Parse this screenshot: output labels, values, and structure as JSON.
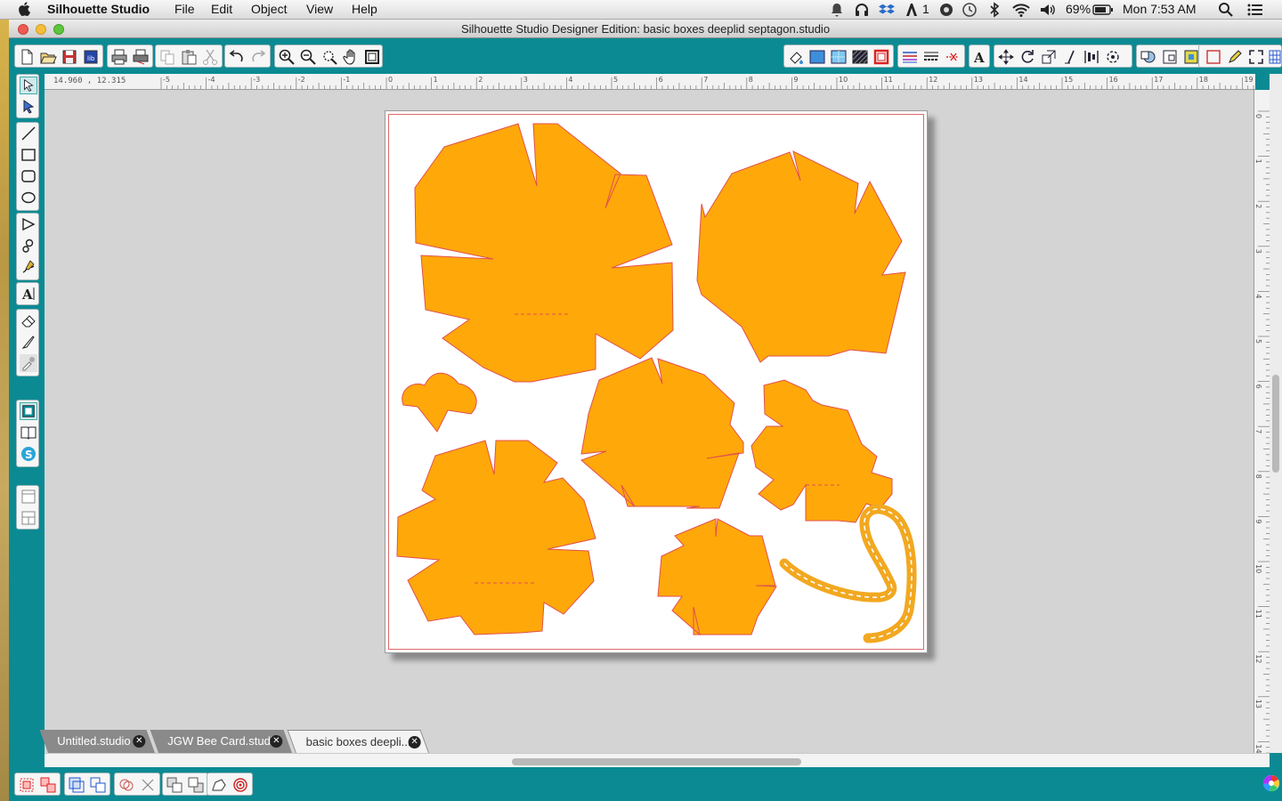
{
  "menubar": {
    "app_name": "Silhouette Studio",
    "menus": [
      "File",
      "Edit",
      "Object",
      "View",
      "Help"
    ],
    "status": {
      "adobe_count": "1",
      "battery": "69%",
      "clock": "Mon 7:53 AM"
    }
  },
  "window": {
    "title": "Silhouette Studio Designer Edition: basic boxes deeplid septagon.studio"
  },
  "ruler": {
    "coordinates": "14.960 , 12.315",
    "h_ticks": [
      "-5",
      "-4",
      "-3",
      "-2",
      "-1",
      "0",
      "1",
      "2",
      "3",
      "4",
      "5",
      "6",
      "7",
      "8",
      "9",
      "10",
      "11",
      "12",
      "13",
      "14",
      "15",
      "16",
      "17",
      "18",
      "19"
    ],
    "v_ticks": [
      "0",
      "1",
      "2",
      "3",
      "4",
      "5",
      "6",
      "7",
      "8",
      "9",
      "10",
      "11",
      "12",
      "13",
      "14"
    ]
  },
  "tabs": [
    {
      "label": "Untitled.studio",
      "active": false
    },
    {
      "label": "JGW Bee Card.studio",
      "active": false
    },
    {
      "label": "basic boxes deepli...",
      "active": true
    }
  ],
  "colors": {
    "app_teal": "#0b8a93",
    "shape_fill": "#ffa80a",
    "cut_line": "#e0504f",
    "canvas_gray": "#d4d4d4"
  },
  "icons": {
    "toolbar_left": [
      "new-file-icon",
      "open-file-icon",
      "save-icon",
      "save-library-icon",
      "print-icon",
      "print-cut-icon",
      "copy-icon",
      "paste-icon",
      "cut-icon",
      "undo-icon",
      "redo-icon",
      "zoom-in-icon",
      "zoom-out-icon",
      "zoom-select-icon",
      "pan-icon",
      "fit-page-icon"
    ],
    "toolbar_right": [
      "fill-color-icon",
      "fill-panel-icon",
      "gradient-icon",
      "pattern-icon",
      "line-color-icon",
      "line-style-icon",
      "line-weight-icon",
      "cut-style-icon",
      "text-style-icon",
      "transform-move-icon",
      "rotate-icon",
      "scale-icon",
      "shear-icon",
      "align-icon",
      "replicate-icon",
      "offset-icon",
      "trace-icon",
      "page-setup-icon",
      "registration-icon",
      "grid-icon",
      "sketch-icon",
      "fullscreen-icon",
      "grid-view-icon"
    ],
    "left_tools": [
      "select-icon",
      "edit-points-icon",
      "line-tool-icon",
      "rectangle-tool-icon",
      "rounded-rect-tool-icon",
      "ellipse-tool-icon",
      "polygon-tool-icon",
      "curve-tool-icon",
      "freehand-tool-icon",
      "text-tool-icon",
      "eraser-tool-icon",
      "knife-tool-icon",
      "eyedropper-icon",
      "design-page-icon",
      "library-icon",
      "silhouette-store-icon",
      "show-panel-icon",
      "split-panel-icon"
    ],
    "bottom_tools": [
      "group-icon",
      "ungroup-icon",
      "compound-icon",
      "release-compound-icon",
      "weld-icon",
      "delete-icon",
      "bring-forward-icon",
      "send-backward-icon",
      "rotate-object-icon",
      "target-icon",
      "color-wheel-icon"
    ]
  }
}
